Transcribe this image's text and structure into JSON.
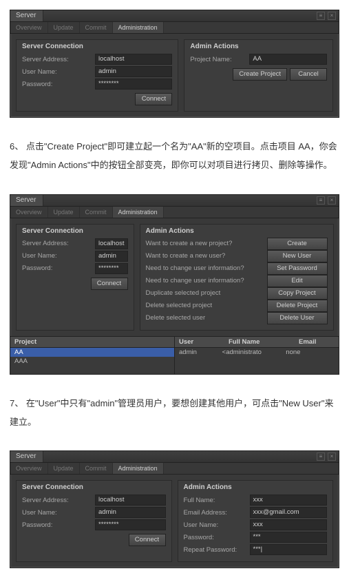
{
  "panel_common": {
    "title": "Server",
    "tabs": {
      "overview": "Overview",
      "update": "Update",
      "commit": "Commit",
      "admin": "Administration"
    },
    "win": {
      "menu": "≡",
      "close": "×"
    }
  },
  "server_conn": {
    "legend": "Server Connection",
    "server_address_label": "Server Address:",
    "server_address_value": "localhost",
    "user_name_label": "User Name:",
    "user_name_value": "admin",
    "password_label": "Password:",
    "password_value": "********",
    "connect_label": "Connect"
  },
  "panel1": {
    "aa_legend": "Admin Actions",
    "project_name_label": "Project Name:",
    "project_name_value": "AA",
    "create_project_label": "Create Project",
    "cancel_label": "Cancel"
  },
  "para6": "6、 点击\"Create Project\"即可建立起一个名为\"AA\"新的空项目。点击项目 AA，你会发现\"Admin Actions\"中的按钮全部变亮，即你可以对项目进行拷贝、删除等操作。",
  "panel2": {
    "aa_legend": "Admin Actions",
    "rows": [
      {
        "q": "Want to create a new project?",
        "b": "Create"
      },
      {
        "q": "Want to create a new user?",
        "b": "New User"
      },
      {
        "q": "Need to change user information?",
        "b": "Set Password"
      },
      {
        "q": "Need to change user information?",
        "b": "Edit"
      },
      {
        "q": "Duplicate selected project",
        "b": "Copy Project"
      },
      {
        "q": "Delete selected project",
        "b": "Delete Project"
      },
      {
        "q": "Delete selected user",
        "b": "Delete User"
      }
    ],
    "project_head": "Project",
    "user_head": "User",
    "fullname_head": "Full Name",
    "email_head": "Email",
    "projects": [
      "AA",
      "AAA"
    ],
    "users": [
      {
        "user": "admin",
        "fullname": "<administrato",
        "email": "none"
      }
    ]
  },
  "para7": "7、 在\"User\"中只有\"admin\"管理员用户，要想创建其他用户，可点击\"New User\"来建立。",
  "panel3": {
    "aa_legend": "Admin Actions",
    "fullname_label": "Full Name:",
    "fullname_value": "xxx",
    "email_label": "Email Address:",
    "email_value": "xxx@gmail.com",
    "username_label": "User Name:",
    "username_value": "xxx",
    "password_label": "Password:",
    "password_value": "***",
    "repeat_label": "Repeat Password:",
    "repeat_value": "***|"
  }
}
